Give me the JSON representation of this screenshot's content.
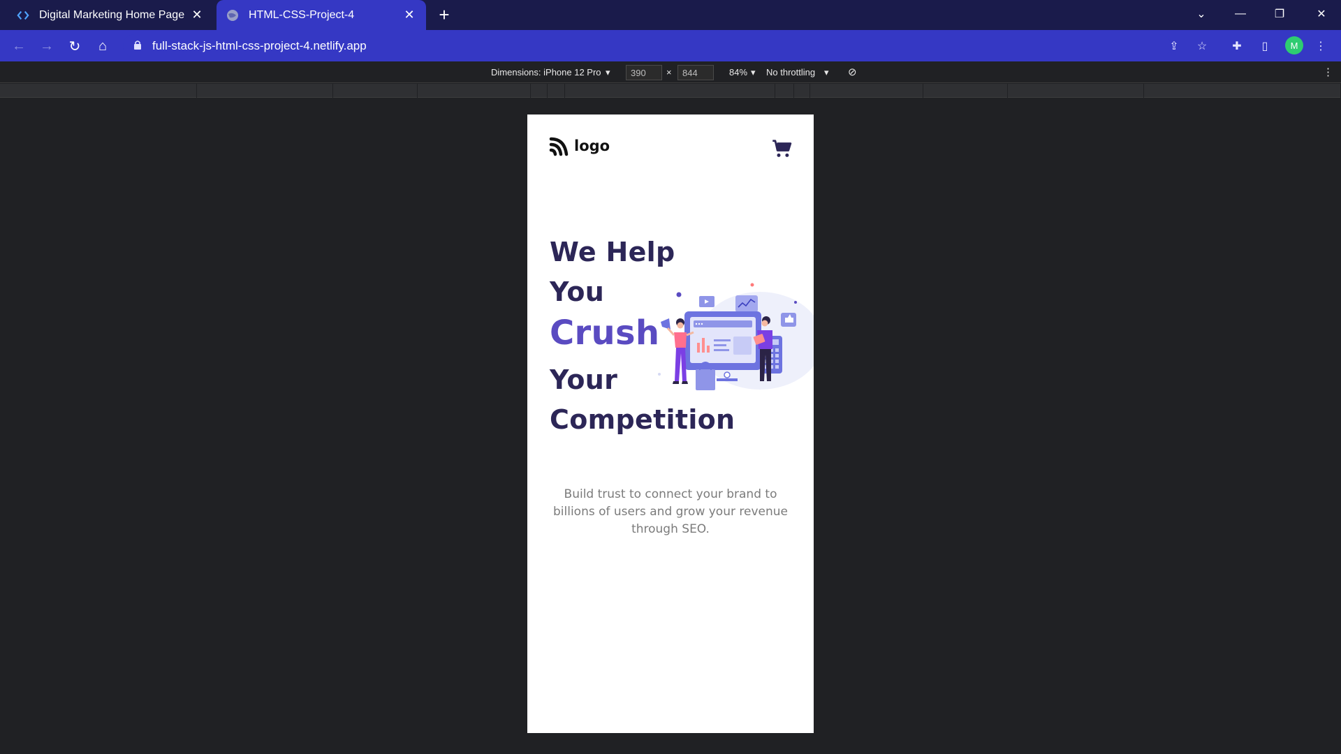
{
  "browser": {
    "tabs": [
      {
        "title": "Digital Marketing Home Page",
        "active": false
      },
      {
        "title": "HTML-CSS-Project-4",
        "active": true
      }
    ],
    "url": "full-stack-js-html-css-project-4.netlify.app",
    "profile_initial": "M"
  },
  "devtools": {
    "dimensions_label": "Dimensions: iPhone 12 Pro",
    "width": "390",
    "height": "844",
    "times": "×",
    "zoom": "84%",
    "throttling": "No throttling"
  },
  "page": {
    "logo_text": "logo",
    "hero": {
      "line1": "We Help",
      "line2": "You",
      "line3": "Crush",
      "line4": "Your",
      "line5": "Competition"
    },
    "tagline": "Build trust to connect your brand to billions of users and grow your revenue through SEO."
  },
  "colors": {
    "tabstrip": "#1a1b4b",
    "toolbar": "#3538c4",
    "hero_text": "#2c2657",
    "hero_accent": "#5a4bc1",
    "cart": "#2c2657"
  },
  "icons": [
    "code-brackets-icon",
    "globe-icon",
    "close-icon",
    "plus-icon",
    "back-icon",
    "forward-icon",
    "reload-icon",
    "home-icon",
    "lock-icon",
    "share-icon",
    "star-icon",
    "puzzle-icon",
    "sidepanel-icon",
    "kebab-menu-icon",
    "rotate-icon",
    "cart-icon"
  ]
}
